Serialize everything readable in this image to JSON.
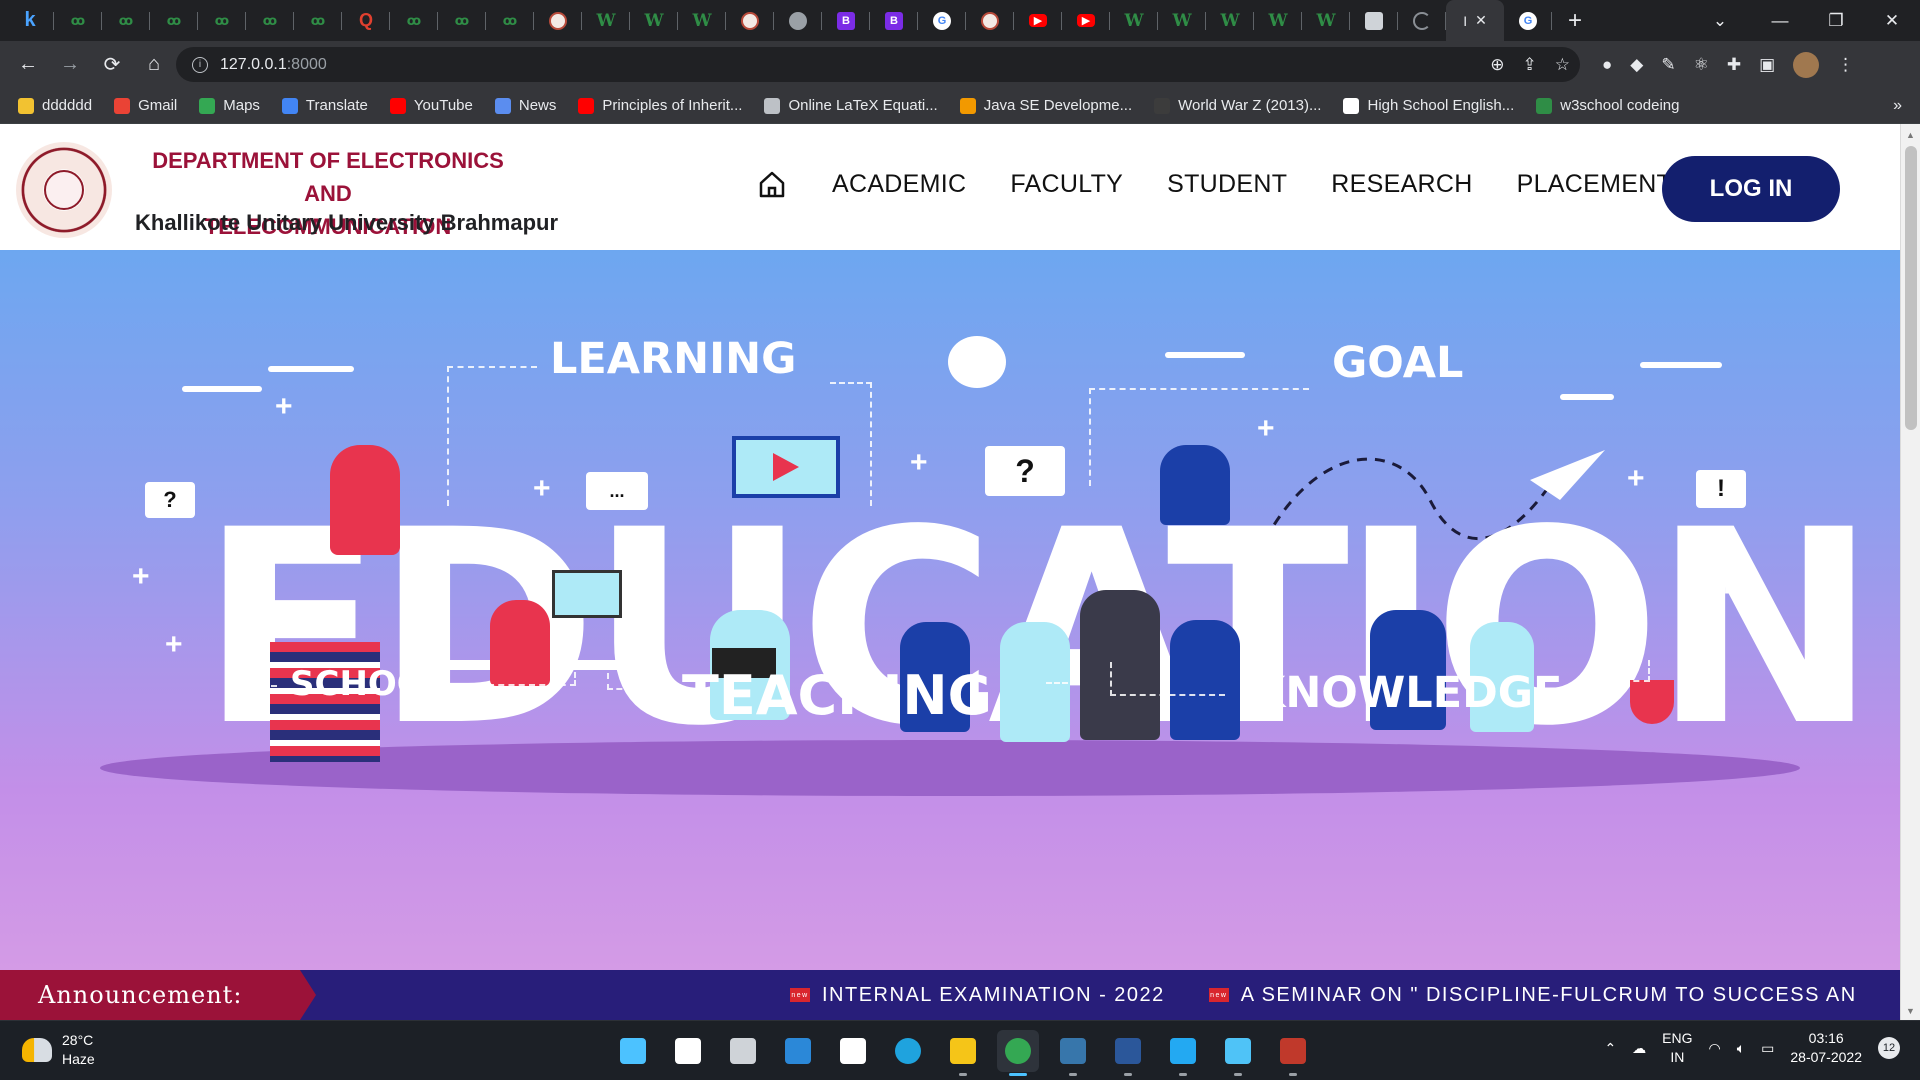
{
  "browser": {
    "tabs": [
      {
        "icon": "k-icon",
        "glyph": "k"
      },
      {
        "icon": "geeksforgeeks-icon",
        "glyph": "ꝏ"
      },
      {
        "icon": "geeksforgeeks-icon",
        "glyph": "ꝏ"
      },
      {
        "icon": "geeksforgeeks-icon",
        "glyph": "ꝏ"
      },
      {
        "icon": "geeksforgeeks-icon",
        "glyph": "ꝏ"
      },
      {
        "icon": "geeksforgeeks-icon",
        "glyph": "ꝏ"
      },
      {
        "icon": "geeksforgeeks-icon",
        "glyph": "ꝏ"
      },
      {
        "icon": "quora-icon",
        "glyph": "Q"
      },
      {
        "icon": "geeksforgeeks-icon",
        "glyph": "ꝏ"
      },
      {
        "icon": "geeksforgeeks-icon",
        "glyph": "ꝏ"
      },
      {
        "icon": "geeksforgeeks-icon",
        "glyph": "ꝏ"
      },
      {
        "icon": "university-seal-icon",
        "glyph": ""
      },
      {
        "icon": "w3schools-icon",
        "glyph": "W"
      },
      {
        "icon": "w3schools-icon",
        "glyph": "W"
      },
      {
        "icon": "w3schools-icon",
        "glyph": "W"
      },
      {
        "icon": "university-seal-icon",
        "glyph": ""
      },
      {
        "icon": "globe-icon",
        "glyph": ""
      },
      {
        "icon": "bootstrap-icon",
        "glyph": "B"
      },
      {
        "icon": "bootstrap-icon",
        "glyph": "B"
      },
      {
        "icon": "google-icon",
        "glyph": "G"
      },
      {
        "icon": "university-seal-icon",
        "glyph": ""
      },
      {
        "icon": "youtube-icon",
        "glyph": "▶"
      },
      {
        "icon": "youtube-icon",
        "glyph": "▶"
      },
      {
        "icon": "w3schools-icon",
        "glyph": "W"
      },
      {
        "icon": "w3schools-icon",
        "glyph": "W"
      },
      {
        "icon": "w3schools-icon",
        "glyph": "W"
      },
      {
        "icon": "w3schools-icon",
        "glyph": "W"
      },
      {
        "icon": "w3schools-icon",
        "glyph": "W"
      },
      {
        "icon": "image-icon",
        "glyph": ""
      },
      {
        "icon": "loading-icon",
        "glyph": ""
      }
    ],
    "active_tab": {
      "title_fragment": "I",
      "close": "✕"
    },
    "trailing_tab_icon": "google-icon",
    "new_tab": "+",
    "window_controls": {
      "minimize": "—",
      "restore": "❐",
      "close": "✕",
      "tab_search": "⌄"
    },
    "url": {
      "host": "127.0.0.1",
      "port": ":8000"
    },
    "bookmarks": [
      {
        "label": "dddddd",
        "icon": "folder-icon",
        "color": "#f2c231"
      },
      {
        "label": "Gmail",
        "icon": "gmail-icon",
        "color": "#ea4335"
      },
      {
        "label": "Maps",
        "icon": "maps-icon",
        "color": "#34a853"
      },
      {
        "label": "Translate",
        "icon": "translate-icon",
        "color": "#4285f4"
      },
      {
        "label": "YouTube",
        "icon": "youtube-icon",
        "color": "#ff0000"
      },
      {
        "label": "News",
        "icon": "news-icon",
        "color": "#5b8def"
      },
      {
        "label": "Principles of Inherit...",
        "icon": "youtube-icon",
        "color": "#ff0000"
      },
      {
        "label": "Online LaTeX Equati...",
        "icon": "gear-icon",
        "color": "#bdc1c6"
      },
      {
        "label": "Java SE Developme...",
        "icon": "google-g-icon",
        "color": "#f29900"
      },
      {
        "label": "World War Z (2013)...",
        "icon": "imdb-icon",
        "color": "#3c3c3c"
      },
      {
        "label": "High School English...",
        "icon": "google-icon",
        "color": "#ffffff"
      },
      {
        "label": "w3school codeing",
        "icon": "w3schools-icon",
        "color": "#2f8d46"
      }
    ]
  },
  "site": {
    "dept_line1": "DEPARTMENT OF ELECTRONICS AND",
    "dept_line2": "TELECOMMUNICATION",
    "university": "Khallikote Unitary University Brahmapur",
    "nav": [
      "ACADEMIC",
      "FACULTY",
      "STUDENT",
      "RESEARCH",
      "PLACEMENT"
    ],
    "login": "LOG IN",
    "hero": {
      "words": {
        "learning": "LEARNING",
        "goal": "GOAL",
        "school": "SCHOOL",
        "teaching": "TEACHING",
        "knowledge": "KNOWLEDGE",
        "education": "EDUCATION"
      },
      "bubbles": {
        "q1": "?",
        "dots": "...",
        "q2": "?",
        "excl": "!"
      }
    },
    "announcement": {
      "label": "Announcement:",
      "new_badge": "new",
      "items": [
        "INTERNAL EXAMINATION - 2022",
        "A SEMINAR ON \" DISCIPLINE-FULCRUM TO SUCCESS AN"
      ]
    }
  },
  "taskbar": {
    "weather": {
      "temp": "28°C",
      "condition": "Haze"
    },
    "apps": [
      {
        "name": "windows-start-icon",
        "color": "#4cc2ff"
      },
      {
        "name": "search-icon",
        "color": "#ffffff"
      },
      {
        "name": "task-view-icon",
        "color": "#cfd3d8"
      },
      {
        "name": "mail-icon",
        "color": "#2b88d8"
      },
      {
        "name": "store-icon",
        "color": "#ffffff"
      },
      {
        "name": "edge-icon",
        "color": "#1fa3de"
      },
      {
        "name": "file-explorer-icon",
        "color": "#f5c518"
      },
      {
        "name": "chrome-icon",
        "color": "#34a853"
      },
      {
        "name": "python-icon",
        "color": "#3776ab"
      },
      {
        "name": "word-icon",
        "color": "#2b579a"
      },
      {
        "name": "vscode-icon",
        "color": "#23a9f2"
      },
      {
        "name": "notepad-icon",
        "color": "#4fc3f7"
      },
      {
        "name": "acrobat-icon",
        "color": "#c0392b"
      }
    ],
    "lang": {
      "line1": "ENG",
      "line2": "IN"
    },
    "clock": {
      "time": "03:16",
      "date": "28-07-2022"
    },
    "notifications": "12"
  }
}
